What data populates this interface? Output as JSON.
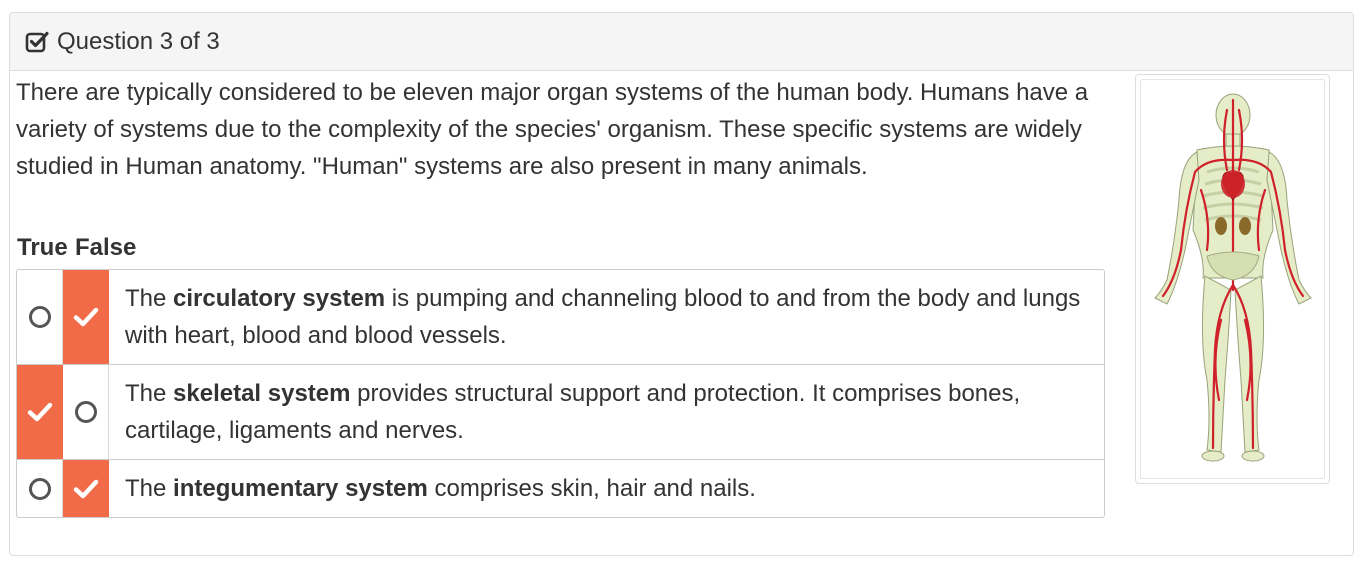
{
  "header": {
    "title": "Question 3 of 3",
    "icon": "checkbox-checked-icon"
  },
  "question": {
    "intro": "There are typically considered to be eleven major organ systems of the human body. Humans have a variety of systems due to the complexity of the species' organism. These specific systems are widely studied in Human anatomy. \"Human\" systems are also present in many animals."
  },
  "columns": {
    "true_label": "True",
    "false_label": "False"
  },
  "statements": [
    {
      "prefix": "The ",
      "bold": "circulatory system",
      "suffix": " is pumping and channeling blood to and from the body and lungs with heart, blood and blood vessels.",
      "selected": "false"
    },
    {
      "prefix": "The ",
      "bold": "skeletal system",
      "suffix": " provides structural support and protection. It comprises bones, cartilage, ligaments and nerves.",
      "selected": "true"
    },
    {
      "prefix": "The ",
      "bold": "integumentary system",
      "suffix": " comprises skin, hair and nails.",
      "selected": "false"
    }
  ],
  "image": {
    "subject": "human circulatory system anatomy illustration"
  },
  "colors": {
    "selected": "#f26b49",
    "panel_heading_bg": "#f5f5f5",
    "border": "#dddddd",
    "artery": "#d0202a",
    "bone": "#dfe8c0"
  }
}
